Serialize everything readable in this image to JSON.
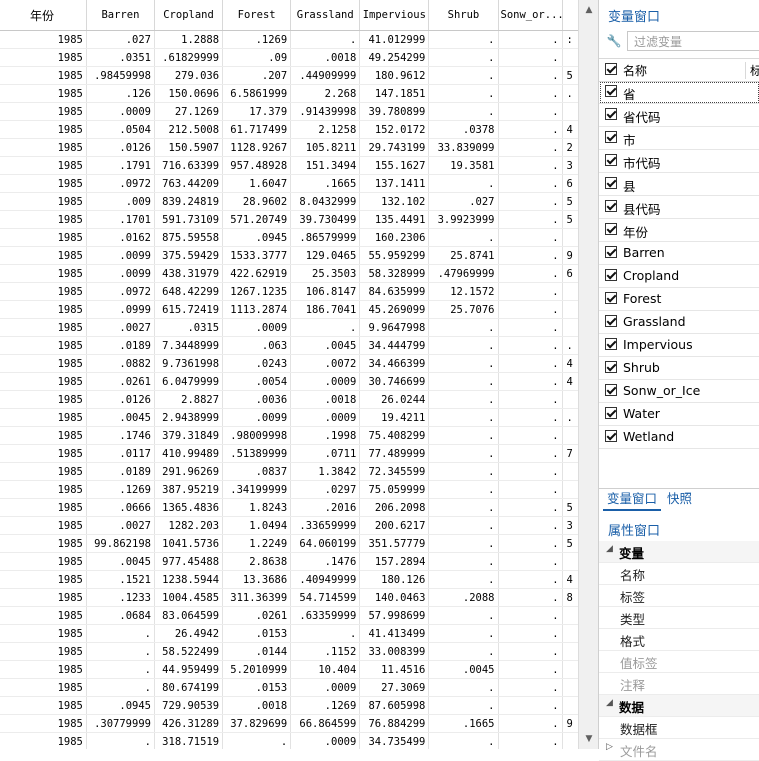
{
  "grid": {
    "columns": [
      "年份",
      "Barren",
      "Cropland",
      "Forest",
      "Grassland",
      "Impervious",
      "Shrub",
      "Sonw_or..."
    ],
    "rows": [
      [
        "1985",
        ".027",
        "1.2888",
        ".1269",
        ".",
        "41.012999",
        ".",
        ".",
        ":"
      ],
      [
        "1985",
        ".0351",
        ".61829999",
        ".09",
        ".0018",
        "49.254299",
        ".",
        ".",
        ""
      ],
      [
        "1985",
        ".98459998",
        "279.036",
        ".207",
        ".44909999",
        "180.9612",
        ".",
        ".",
        "5"
      ],
      [
        "1985",
        ".126",
        "150.0696",
        "6.5861999",
        "2.268",
        "147.1851",
        ".",
        ".",
        "."
      ],
      [
        "1985",
        ".0009",
        "27.1269",
        "17.379",
        ".91439998",
        "39.780899",
        ".",
        ".",
        ""
      ],
      [
        "1985",
        ".0504",
        "212.5008",
        "61.717499",
        "2.1258",
        "152.0172",
        ".0378",
        ".",
        "4"
      ],
      [
        "1985",
        ".0126",
        "150.5907",
        "1128.9267",
        "105.8211",
        "29.743199",
        "33.839099",
        ".",
        "2"
      ],
      [
        "1985",
        ".1791",
        "716.63399",
        "957.48928",
        "151.3494",
        "155.1627",
        "19.3581",
        ".",
        "3"
      ],
      [
        "1985",
        ".0972",
        "763.44209",
        "1.6047",
        ".1665",
        "137.1411",
        ".",
        ".",
        "6"
      ],
      [
        "1985",
        ".009",
        "839.24819",
        "28.9602",
        "8.0432999",
        "132.102",
        ".027",
        ".",
        "5"
      ],
      [
        "1985",
        ".1701",
        "591.73109",
        "571.20749",
        "39.730499",
        "135.4491",
        "3.9923999",
        ".",
        "5"
      ],
      [
        "1985",
        ".0162",
        "875.59558",
        ".0945",
        ".86579999",
        "160.2306",
        ".",
        ".",
        ""
      ],
      [
        "1985",
        ".0099",
        "375.59429",
        "1533.3777",
        "129.0465",
        "55.959299",
        "25.8741",
        ".",
        "9"
      ],
      [
        "1985",
        ".0099",
        "438.31979",
        "422.62919",
        "25.3503",
        "58.328999",
        ".47969999",
        ".",
        "6"
      ],
      [
        "1985",
        ".0972",
        "648.42299",
        "1267.1235",
        "106.8147",
        "84.635999",
        "12.1572",
        ".",
        ""
      ],
      [
        "1985",
        ".0999",
        "615.72419",
        "1113.2874",
        "186.7041",
        "45.269099",
        "25.7076",
        ".",
        ""
      ],
      [
        "1985",
        ".0027",
        ".0315",
        ".0009",
        ".",
        "9.9647998",
        ".",
        ".",
        ""
      ],
      [
        "1985",
        ".0189",
        "7.3448999",
        ".063",
        ".0045",
        "34.444799",
        ".",
        ".",
        "."
      ],
      [
        "1985",
        ".0882",
        "9.7361998",
        ".0243",
        ".0072",
        "34.466399",
        ".",
        ".",
        "4"
      ],
      [
        "1985",
        ".0261",
        "6.0479999",
        ".0054",
        ".0009",
        "30.746699",
        ".",
        ".",
        "4"
      ],
      [
        "1985",
        ".0126",
        "2.8827",
        ".0036",
        ".0018",
        "26.0244",
        ".",
        ".",
        ""
      ],
      [
        "1985",
        ".0045",
        "2.9438999",
        ".0099",
        ".0009",
        "19.4211",
        ".",
        ".",
        "."
      ],
      [
        "1985",
        ".1746",
        "379.31849",
        ".98009998",
        ".1998",
        "75.408299",
        ".",
        ".",
        ""
      ],
      [
        "1985",
        ".0117",
        "410.99489",
        ".51389999",
        ".0711",
        "77.489999",
        ".",
        ".",
        "7"
      ],
      [
        "1985",
        ".0189",
        "291.96269",
        ".0837",
        "1.3842",
        "72.345599",
        ".",
        ".",
        ""
      ],
      [
        "1985",
        ".1269",
        "387.95219",
        ".34199999",
        ".0297",
        "75.059999",
        ".",
        ".",
        ""
      ],
      [
        "1985",
        ".0666",
        "1365.4836",
        "1.8243",
        ".2016",
        "206.2098",
        ".",
        ".",
        "5"
      ],
      [
        "1985",
        ".0027",
        "1282.203",
        "1.0494",
        ".33659999",
        "200.6217",
        ".",
        ".",
        "3"
      ],
      [
        "1985",
        "99.862198",
        "1041.5736",
        "1.2249",
        "64.060199",
        "351.57779",
        ".",
        ".",
        "5"
      ],
      [
        "1985",
        ".0045",
        "977.45488",
        "2.8638",
        ".1476",
        "157.2894",
        ".",
        ".",
        ""
      ],
      [
        "1985",
        ".1521",
        "1238.5944",
        "13.3686",
        ".40949999",
        "180.126",
        ".",
        ".",
        "4"
      ],
      [
        "1985",
        ".1233",
        "1004.4585",
        "311.36399",
        "54.714599",
        "140.0463",
        ".2088",
        ".",
        "8"
      ],
      [
        "1985",
        ".0684",
        "83.064599",
        ".0261",
        ".63359999",
        "57.998699",
        ".",
        ".",
        ""
      ],
      [
        "1985",
        ".",
        "26.4942",
        ".0153",
        ".",
        "41.413499",
        ".",
        ".",
        ""
      ],
      [
        "1985",
        ".",
        "58.522499",
        ".0144",
        ".1152",
        "33.008399",
        ".",
        ".",
        ""
      ],
      [
        "1985",
        ".",
        "44.959499",
        "5.2010999",
        "10.404",
        "11.4516",
        ".0045",
        ".",
        ""
      ],
      [
        "1985",
        ".",
        "80.674199",
        ".0153",
        ".0009",
        "27.3069",
        ".",
        ".",
        ""
      ],
      [
        "1985",
        ".0945",
        "729.90539",
        ".0018",
        ".1269",
        "87.605998",
        ".",
        ".",
        ""
      ],
      [
        "1985",
        ".30779999",
        "426.31289",
        "37.829699",
        "66.864599",
        "76.884299",
        ".1665",
        ".",
        "9"
      ],
      [
        "1985",
        ".",
        "318.71519",
        ".",
        ".0009",
        "34.735499",
        ".",
        ".",
        ""
      ]
    ]
  },
  "variables_window": {
    "title": "变量窗口",
    "filter_placeholder": "过滤变量",
    "header_name": "名称",
    "header_label": "标",
    "variables": [
      "省",
      "省代码",
      "市",
      "市代码",
      "县",
      "县代码",
      "年份",
      "Barren",
      "Cropland",
      "Forest",
      "Grassland",
      "Impervious",
      "Shrub",
      "Sonw_or_Ice",
      "Water",
      "Wetland"
    ],
    "selected_index": 0
  },
  "tabs": {
    "variables": "变量窗口",
    "snapshots": "快照"
  },
  "properties_window": {
    "title": "属性窗口",
    "sections": [
      {
        "label": "变量",
        "items": [
          "名称",
          "标签",
          "类型",
          "格式",
          "值标签",
          "注释"
        ],
        "dimmed": [
          "值标签",
          "注释"
        ]
      },
      {
        "label": "数据",
        "items": [
          "数据框"
        ]
      }
    ],
    "collapsed_section": "文件名"
  },
  "icons": {
    "filter": "wrench-icon"
  }
}
